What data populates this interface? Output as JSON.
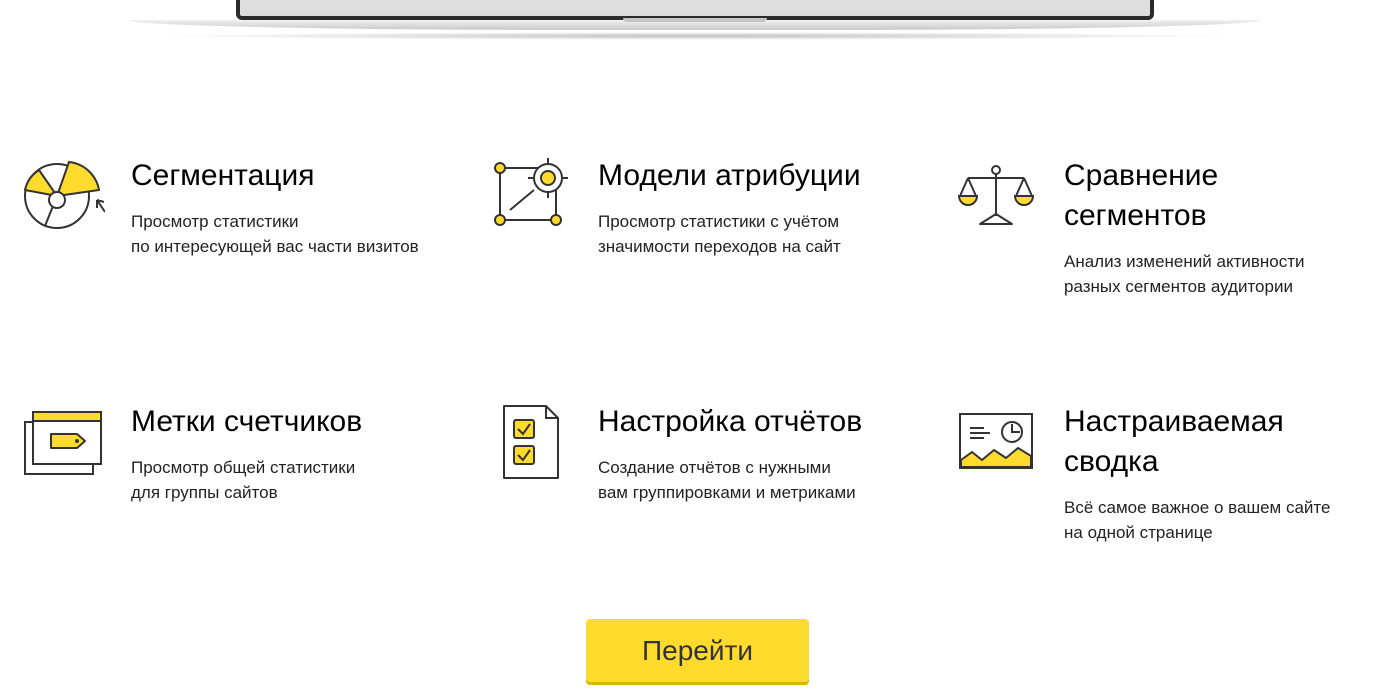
{
  "colors": {
    "accent": "#ffdb2e",
    "accent_dark": "#f2c400",
    "icon_stroke": "#333333"
  },
  "features": [
    {
      "title_lines": [
        "Сегментация"
      ],
      "desc_lines": [
        "Просмотр статистики",
        "по интересующей вас части визитов"
      ],
      "icon": "segmentation-pie-icon"
    },
    {
      "title_lines": [
        "Модели атрибуции"
      ],
      "desc_lines": [
        "Просмотр статистики с учётом",
        "значимости переходов на сайт"
      ],
      "icon": "attribution-target-icon"
    },
    {
      "title_lines": [
        "Сравнение",
        "сегментов"
      ],
      "desc_lines": [
        "Анализ изменений активности",
        "разных сегментов аудитории"
      ],
      "icon": "scales-icon"
    },
    {
      "title_lines": [
        "Метки счетчиков"
      ],
      "desc_lines": [
        "Просмотр общей статистики",
        "для группы сайтов"
      ],
      "icon": "counter-tag-icon"
    },
    {
      "title_lines": [
        "Настройка отчётов"
      ],
      "desc_lines": [
        "Создание отчётов с нужными",
        "вам группировками и метриками"
      ],
      "icon": "report-checklist-icon"
    },
    {
      "title_lines": [
        "Настраиваемая",
        "сводка"
      ],
      "desc_lines": [
        "Всё самое важное о вашем сайте",
        "на одной странице"
      ],
      "icon": "dashboard-summary-icon"
    }
  ],
  "cta": {
    "label": "Перейти"
  }
}
